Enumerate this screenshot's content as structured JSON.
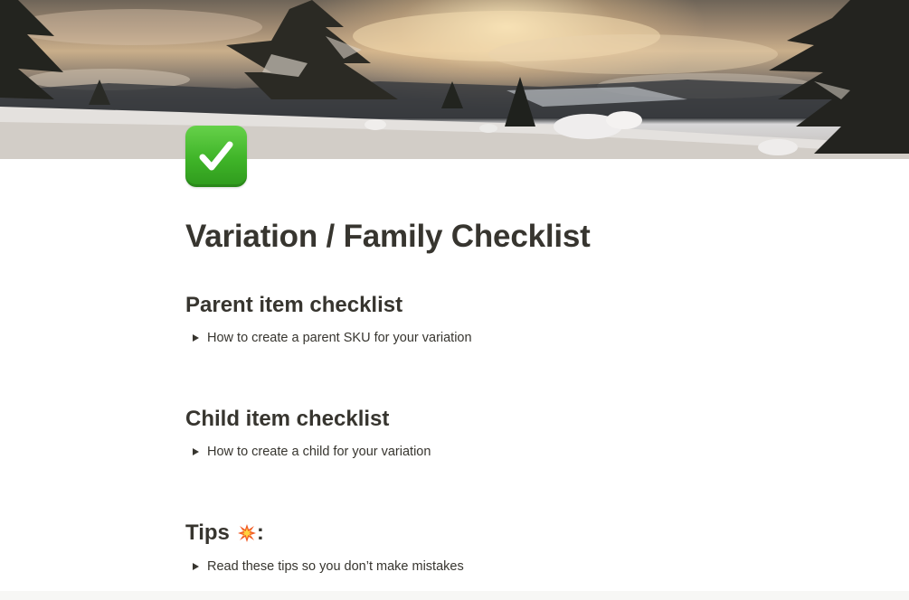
{
  "cover": {
    "icon_name": "winter-sunset-cover-image"
  },
  "page_icon": {
    "icon_name": "white-check-mark-icon",
    "color": "#3fb428"
  },
  "page": {
    "title": "Variation / Family Checklist"
  },
  "sections": [
    {
      "heading": "Parent item checklist",
      "toggle_label": "How to create a parent SKU for your variation"
    },
    {
      "heading": "Child item checklist",
      "toggle_label": "How to create a child for your variation"
    },
    {
      "heading": "Tips",
      "heading_icon": "collision-icon",
      "heading_suffix": ":",
      "toggle_label": "Read these tips so you don’t make mistakes"
    }
  ],
  "colors": {
    "text": "#37352f",
    "background": "#ffffff"
  }
}
